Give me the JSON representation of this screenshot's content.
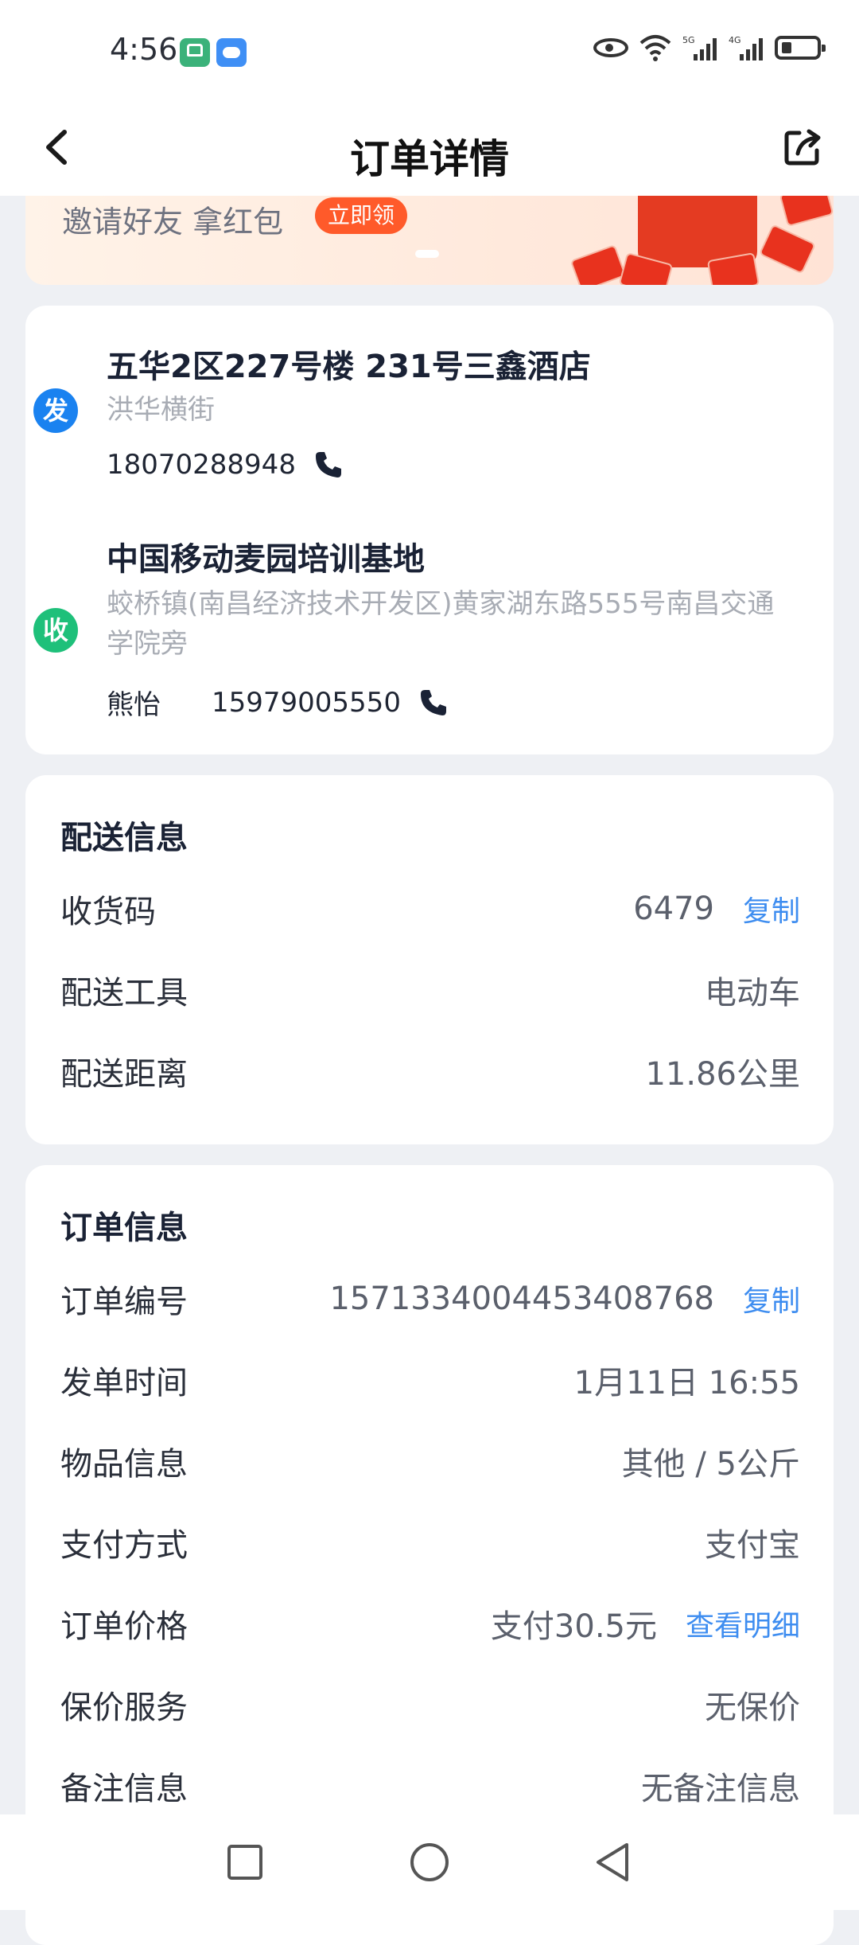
{
  "status_bar": {
    "time": "4:56",
    "signal_labels": [
      "5G",
      "4G"
    ]
  },
  "header": {
    "title": "订单详情"
  },
  "banner": {
    "text": "邀请好友 拿红包",
    "button": "立即领"
  },
  "sender": {
    "badge": "发",
    "title": "五华2区227号楼 231号三鑫酒店",
    "subtitle": "洪华横街",
    "phone": "18070288948"
  },
  "receiver": {
    "badge": "收",
    "title": "中国移动麦园培训基地",
    "subtitle": "蛟桥镇(南昌经济技术开发区)黄家湖东路555号南昌交通学院旁",
    "name": "熊怡",
    "phone": "15979005550"
  },
  "delivery": {
    "title": "配送信息",
    "rows": [
      {
        "label": "收货码",
        "value": "6479",
        "link": "复制"
      },
      {
        "label": "配送工具",
        "value": "电动车"
      },
      {
        "label": "配送距离",
        "value": "11.86公里"
      }
    ]
  },
  "order": {
    "title": "订单信息",
    "rows": [
      {
        "label": "订单编号",
        "value": "1571334004453408768",
        "link": "复制"
      },
      {
        "label": "发单时间",
        "value": "1月11日 16:55"
      },
      {
        "label": "物品信息",
        "value": "其他 / 5公斤"
      },
      {
        "label": "支付方式",
        "value": "支付宝"
      },
      {
        "label": "订单价格",
        "value": "支付30.5元",
        "link": "查看明细"
      },
      {
        "label": "保价服务",
        "value": "无保价"
      },
      {
        "label": "备注信息",
        "value": "无备注信息"
      }
    ]
  },
  "colors": {
    "accent": "#3e8df0",
    "send_badge": "#1a82f0",
    "recv_badge": "#1ec07a",
    "banner_button": "#ff5a2a"
  }
}
